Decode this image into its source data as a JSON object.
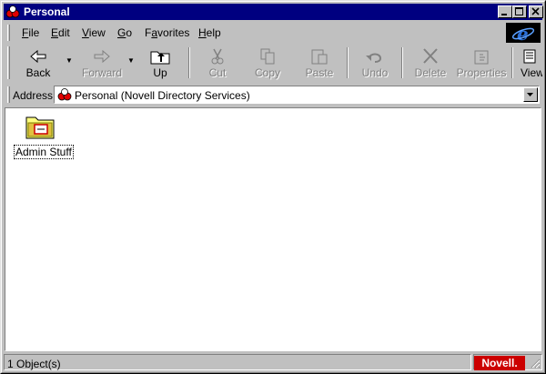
{
  "window": {
    "title": "Personal",
    "controls": {
      "minimize": "minimize-icon",
      "maximize": "maximize-icon",
      "close": "close-icon"
    }
  },
  "menubar": {
    "items": [
      {
        "label": "File",
        "accel": "F",
        "rest": "ile"
      },
      {
        "label": "Edit",
        "accel": "E",
        "rest": "dit"
      },
      {
        "label": "View",
        "accel": "V",
        "rest": "iew"
      },
      {
        "label": "Go",
        "accel": "G",
        "rest": "o"
      },
      {
        "label": "Favorites",
        "accel": "a",
        "pre": "F",
        "rest": "vorites"
      },
      {
        "label": "Help",
        "accel": "H",
        "rest": "elp"
      }
    ]
  },
  "toolbar": {
    "back": "Back",
    "forward": "Forward",
    "up": "Up",
    "cut": "Cut",
    "copy": "Copy",
    "paste": "Paste",
    "undo": "Undo",
    "delete": "Delete",
    "properties": "Properties",
    "views": "Views"
  },
  "address": {
    "label": "Address",
    "value": "Personal (Novell Directory Services)"
  },
  "content": {
    "items": [
      {
        "name": "Admin Stuff",
        "icon": "folder-icon"
      }
    ]
  },
  "status": {
    "text": "1 Object(s)",
    "brand": "Novell."
  },
  "colors": {
    "titlebar": "#000080",
    "face": "#c0c0c0",
    "brand": "#cc0000"
  }
}
